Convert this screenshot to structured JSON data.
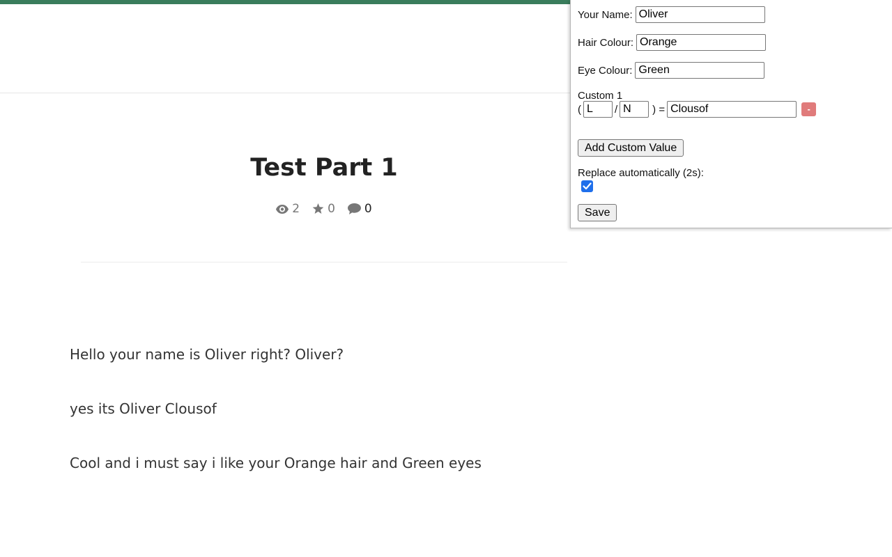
{
  "story": {
    "title": "Test Part 1",
    "stats": {
      "views": "2",
      "stars": "0",
      "comments": "0"
    },
    "paragraphs": [
      "Hello your name is Oliver right? Oliver?",
      "yes its Oliver Clousof",
      "Cool and i must say i like your Orange hair and Green eyes"
    ]
  },
  "popup": {
    "name_label": "Your Name:",
    "name_value": "Oliver",
    "hair_label": "Hair Colour:",
    "hair_value": "Orange",
    "eye_label": "Eye Colour:",
    "eye_value": "Green",
    "custom": {
      "label": "Custom 1",
      "open_paren": "(",
      "slash": "/",
      "close_equals": ") =",
      "key1": "L",
      "key2": "N",
      "value": "Clousof",
      "remove_label": "-"
    },
    "add_button": "Add Custom Value",
    "auto_label": "Replace automatically (2s):",
    "auto_checked": true,
    "save_button": "Save"
  },
  "colors": {
    "top_strip": "#3a7d5c",
    "remove_button": "#e07b7b",
    "checkbox": "#1f6feb"
  }
}
